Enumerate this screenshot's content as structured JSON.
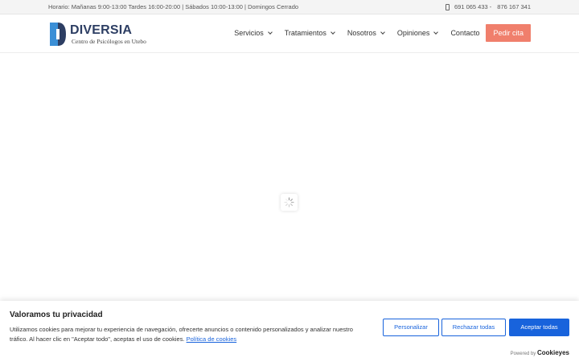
{
  "topbar": {
    "hours": "Horario: Mañanas 9:00-13:00 Tardes 16:00-20:00 | Sábados 10:00-13:00 | Domingos Cerrado",
    "phone1": "691 065 433 -",
    "phone2": "876 167 341"
  },
  "header": {
    "logo_title": "DIVERSIA",
    "logo_subtitle": "Centro de Psicólogos en Utebo",
    "nav": [
      "Servicios",
      "Tratamientos",
      "Nosotros",
      "Opiniones",
      "Contacto"
    ],
    "cta": "Pedir cita"
  },
  "cookie": {
    "title": "Valoramos tu privacidad",
    "text": "Utilizamos cookies para mejorar tu experiencia de navegación, ofrecerte anuncios o contenido personalizados y analizar nuestro tráfico. Al hacer clic en \"Aceptar todo\", aceptas el uso de cookies.",
    "link": "Política de cookies",
    "btn_customize": "Personalizar",
    "btn_reject": "Rechazar todas",
    "btn_accept": "Aceptar todas",
    "powered_by": "Powered by",
    "brand": "Cookieyes"
  },
  "colors": {
    "cta": "#f07f6c",
    "cookie_accent": "#1863dc",
    "logo_navy": "#2d3e63",
    "logo_blue": "#3b8fd6"
  },
  "icons": [
    "phone-icon",
    "chevron-down-icon",
    "loading-spinner-icon",
    "diversia-logo-mark"
  ]
}
